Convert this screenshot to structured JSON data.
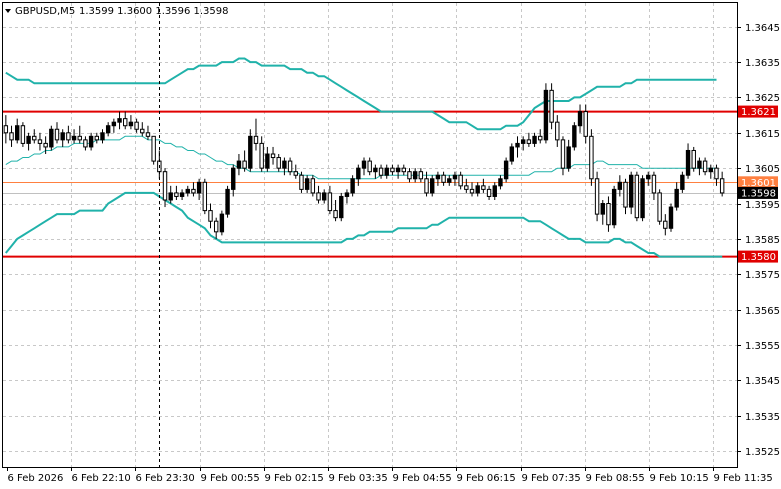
{
  "header": {
    "symbol_label": "GBPUSD,M5",
    "ohlc_label": "1.3599 1.3600 1.3596 1.3598"
  },
  "colors": {
    "background": "#ffffff",
    "grid": "#c8c8c8",
    "frame": "#000000",
    "candle": "#000000",
    "bollinger": "#20b2aa",
    "support_resistance": "#e00000",
    "bid_line": "#ff8040",
    "ask_line": "#c0c0c0",
    "current_tag": "#000000"
  },
  "chart_data": {
    "type": "candlestick",
    "title": "GBPUSD,M5",
    "y_ticks": [
      "1.3645",
      "1.3635",
      "1.3625",
      "1.3615",
      "1.3605",
      "1.3595",
      "1.3585",
      "1.3575",
      "1.3565",
      "1.3555",
      "1.3545",
      "1.3535",
      "1.3525"
    ],
    "x_ticks": [
      "6 Feb 2026",
      "6 Feb 22:10",
      "6 Feb 23:30",
      "9 Feb 00:55",
      "9 Feb 02:15",
      "9 Feb 03:35",
      "9 Feb 04:55",
      "9 Feb 06:15",
      "9 Feb 07:35",
      "9 Feb 08:55",
      "9 Feb 10:15",
      "9 Feb 11:35"
    ],
    "ylim": [
      1.35205,
      1.36517
    ],
    "grid": true,
    "horizontal_levels": [
      {
        "label": "1.3621",
        "value": 1.3621,
        "style": "support_resistance"
      },
      {
        "label": "1.3580",
        "value": 1.358,
        "style": "support_resistance"
      }
    ],
    "price_lines": [
      {
        "label": "1.3601",
        "value": 1.3601,
        "style": "bid_line"
      },
      {
        "label": "1.3598",
        "value": 1.3598,
        "style": "current_tag"
      }
    ],
    "session_separator_x_label": "6 Feb 23:30",
    "candles": [
      [
        1.3617,
        1.362,
        1.3612,
        1.3615
      ],
      [
        1.3615,
        1.3617,
        1.3611,
        1.3613
      ],
      [
        1.3613,
        1.3619,
        1.3612,
        1.3617
      ],
      [
        1.3617,
        1.3618,
        1.3611,
        1.3612
      ],
      [
        1.3612,
        1.3615,
        1.361,
        1.3614
      ],
      [
        1.3614,
        1.3616,
        1.3612,
        1.3613
      ],
      [
        1.3613,
        1.3615,
        1.361,
        1.3612
      ],
      [
        1.3612,
        1.3614,
        1.3609,
        1.3611
      ],
      [
        1.3611,
        1.3617,
        1.361,
        1.3616
      ],
      [
        1.3616,
        1.3618,
        1.3612,
        1.3613
      ],
      [
        1.3613,
        1.3616,
        1.3611,
        1.3615
      ],
      [
        1.3615,
        1.3617,
        1.3612,
        1.3613
      ],
      [
        1.3613,
        1.3616,
        1.3612,
        1.3614
      ],
      [
        1.3614,
        1.3617,
        1.3612,
        1.3613
      ],
      [
        1.3613,
        1.3614,
        1.361,
        1.3611
      ],
      [
        1.3611,
        1.3615,
        1.361,
        1.3614
      ],
      [
        1.3614,
        1.3615,
        1.3612,
        1.3613
      ],
      [
        1.3613,
        1.3616,
        1.3612,
        1.3615
      ],
      [
        1.3615,
        1.3618,
        1.3614,
        1.3617
      ],
      [
        1.3617,
        1.3619,
        1.3615,
        1.3618
      ],
      [
        1.3618,
        1.3621,
        1.3616,
        1.3619
      ],
      [
        1.3619,
        1.3621,
        1.3616,
        1.3617
      ],
      [
        1.3617,
        1.362,
        1.3616,
        1.3618
      ],
      [
        1.3618,
        1.3619,
        1.3615,
        1.3616
      ],
      [
        1.3616,
        1.3618,
        1.3614,
        1.3615
      ],
      [
        1.3615,
        1.3617,
        1.3613,
        1.3614
      ],
      [
        1.3614,
        1.3614,
        1.3606,
        1.3607
      ],
      [
        1.3607,
        1.361,
        1.3602,
        1.3604
      ],
      [
        1.3604,
        1.3605,
        1.3594,
        1.3596
      ],
      [
        1.3596,
        1.36,
        1.3595,
        1.3598
      ],
      [
        1.3598,
        1.36,
        1.3596,
        1.3597
      ],
      [
        1.3597,
        1.3599,
        1.3596,
        1.3598
      ],
      [
        1.3598,
        1.36,
        1.3597,
        1.3599
      ],
      [
        1.3599,
        1.3601,
        1.3597,
        1.3598
      ],
      [
        1.3598,
        1.3602,
        1.3596,
        1.3601
      ],
      [
        1.3601,
        1.3602,
        1.3592,
        1.3593
      ],
      [
        1.3593,
        1.3595,
        1.3588,
        1.359
      ],
      [
        1.359,
        1.3591,
        1.3585,
        1.3587
      ],
      [
        1.3587,
        1.3593,
        1.3586,
        1.3592
      ],
      [
        1.3592,
        1.36,
        1.3591,
        1.3599
      ],
      [
        1.3599,
        1.3606,
        1.3597,
        1.3605
      ],
      [
        1.3605,
        1.3609,
        1.3603,
        1.3607
      ],
      [
        1.3607,
        1.361,
        1.3604,
        1.3605
      ],
      [
        1.3605,
        1.3616,
        1.3604,
        1.3614
      ],
      [
        1.3614,
        1.3619,
        1.361,
        1.3612
      ],
      [
        1.3612,
        1.3614,
        1.3604,
        1.3605
      ],
      [
        1.3605,
        1.3611,
        1.3604,
        1.3609
      ],
      [
        1.3609,
        1.3611,
        1.3606,
        1.3608
      ],
      [
        1.3608,
        1.3609,
        1.3604,
        1.3605
      ],
      [
        1.3605,
        1.3608,
        1.3603,
        1.3607
      ],
      [
        1.3607,
        1.3608,
        1.3603,
        1.3604
      ],
      [
        1.3604,
        1.3606,
        1.3602,
        1.3603
      ],
      [
        1.3603,
        1.3604,
        1.3598,
        1.3599
      ],
      [
        1.3599,
        1.3603,
        1.3598,
        1.3602
      ],
      [
        1.3602,
        1.3603,
        1.3597,
        1.3598
      ],
      [
        1.3598,
        1.36,
        1.3595,
        1.3596
      ],
      [
        1.3596,
        1.3599,
        1.3595,
        1.3598
      ],
      [
        1.3598,
        1.36,
        1.3592,
        1.3593
      ],
      [
        1.3593,
        1.3596,
        1.359,
        1.3591
      ],
      [
        1.3591,
        1.3598,
        1.359,
        1.3597
      ],
      [
        1.3597,
        1.3599,
        1.3595,
        1.3598
      ],
      [
        1.3598,
        1.3603,
        1.3597,
        1.3602
      ],
      [
        1.3602,
        1.3606,
        1.36,
        1.3605
      ],
      [
        1.3605,
        1.3608,
        1.3603,
        1.3607
      ],
      [
        1.3607,
        1.3608,
        1.3603,
        1.3604
      ],
      [
        1.3604,
        1.3606,
        1.3602,
        1.3605
      ],
      [
        1.3605,
        1.3606,
        1.3602,
        1.3603
      ],
      [
        1.3603,
        1.3606,
        1.3602,
        1.3605
      ],
      [
        1.3605,
        1.3606,
        1.3603,
        1.3604
      ],
      [
        1.3604,
        1.3606,
        1.3602,
        1.3605
      ],
      [
        1.3605,
        1.3606,
        1.3603,
        1.3604
      ],
      [
        1.3604,
        1.3605,
        1.3601,
        1.3602
      ],
      [
        1.3602,
        1.3605,
        1.3601,
        1.3604
      ],
      [
        1.3604,
        1.3605,
        1.3601,
        1.3602
      ],
      [
        1.3602,
        1.3604,
        1.3597,
        1.3598
      ],
      [
        1.3598,
        1.3603,
        1.3597,
        1.3602
      ],
      [
        1.3602,
        1.3604,
        1.36,
        1.3603
      ],
      [
        1.3603,
        1.3604,
        1.36,
        1.3601
      ],
      [
        1.3601,
        1.3603,
        1.36,
        1.3602
      ],
      [
        1.3602,
        1.3604,
        1.36,
        1.3603
      ],
      [
        1.3603,
        1.3604,
        1.3599,
        1.36
      ],
      [
        1.36,
        1.3602,
        1.3598,
        1.3599
      ],
      [
        1.3599,
        1.3601,
        1.3597,
        1.3598
      ],
      [
        1.3598,
        1.3601,
        1.3597,
        1.36
      ],
      [
        1.36,
        1.3602,
        1.3598,
        1.3599
      ],
      [
        1.3599,
        1.36,
        1.3596,
        1.3597
      ],
      [
        1.3597,
        1.3601,
        1.3596,
        1.36
      ],
      [
        1.36,
        1.3603,
        1.3599,
        1.3602
      ],
      [
        1.3602,
        1.3608,
        1.3601,
        1.3607
      ],
      [
        1.3607,
        1.3612,
        1.3606,
        1.3611
      ],
      [
        1.3611,
        1.3614,
        1.3608,
        1.3612
      ],
      [
        1.3612,
        1.3614,
        1.361,
        1.3613
      ],
      [
        1.3613,
        1.3615,
        1.3611,
        1.3612
      ],
      [
        1.3612,
        1.3615,
        1.3611,
        1.3614
      ],
      [
        1.3614,
        1.3616,
        1.3612,
        1.3613
      ],
      [
        1.3613,
        1.3629,
        1.3612,
        1.3627
      ],
      [
        1.3627,
        1.3629,
        1.3616,
        1.3618
      ],
      [
        1.3618,
        1.362,
        1.3611,
        1.3613
      ],
      [
        1.3613,
        1.3614,
        1.3603,
        1.3605
      ],
      [
        1.3605,
        1.3613,
        1.3604,
        1.3611
      ],
      [
        1.3611,
        1.3618,
        1.361,
        1.3617
      ],
      [
        1.3617,
        1.3623,
        1.3615,
        1.3621
      ],
      [
        1.3621,
        1.3623,
        1.3612,
        1.3614
      ],
      [
        1.3614,
        1.3616,
        1.36,
        1.3602
      ],
      [
        1.3602,
        1.3604,
        1.359,
        1.3592
      ],
      [
        1.3592,
        1.3596,
        1.3589,
        1.3595
      ],
      [
        1.3595,
        1.3597,
        1.3587,
        1.3589
      ],
      [
        1.3589,
        1.36,
        1.3588,
        1.3599
      ],
      [
        1.3599,
        1.3603,
        1.3597,
        1.3601
      ],
      [
        1.3601,
        1.3602,
        1.3592,
        1.3594
      ],
      [
        1.3594,
        1.3604,
        1.3592,
        1.3603
      ],
      [
        1.3603,
        1.3604,
        1.359,
        1.3591
      ],
      [
        1.3591,
        1.3603,
        1.359,
        1.3602
      ],
      [
        1.3602,
        1.3604,
        1.36,
        1.3603
      ],
      [
        1.3603,
        1.3604,
        1.3596,
        1.3598
      ],
      [
        1.3598,
        1.3599,
        1.3589,
        1.359
      ],
      [
        1.359,
        1.3592,
        1.3586,
        1.3588
      ],
      [
        1.3588,
        1.3595,
        1.3587,
        1.3594
      ],
      [
        1.3594,
        1.3601,
        1.3593,
        1.3599
      ],
      [
        1.3599,
        1.3604,
        1.3598,
        1.3603
      ],
      [
        1.3603,
        1.3612,
        1.3602,
        1.361
      ],
      [
        1.361,
        1.3611,
        1.3604,
        1.3605
      ],
      [
        1.3605,
        1.3608,
        1.3603,
        1.3607
      ],
      [
        1.3607,
        1.3608,
        1.3603,
        1.3604
      ],
      [
        1.3604,
        1.3606,
        1.3602,
        1.3605
      ],
      [
        1.3605,
        1.3606,
        1.36,
        1.3602
      ],
      [
        1.3602,
        1.3604,
        1.3597,
        1.3598
      ]
    ],
    "bollinger_upper": [
      1.3632,
      1.3631,
      1.363,
      1.363,
      1.363,
      1.3629,
      1.3629,
      1.3629,
      1.3629,
      1.3629,
      1.3629,
      1.3629,
      1.3629,
      1.3629,
      1.3629,
      1.3629,
      1.3629,
      1.3629,
      1.3629,
      1.3629,
      1.3629,
      1.3629,
      1.3629,
      1.3629,
      1.3629,
      1.3629,
      1.3629,
      1.3629,
      1.3629,
      1.363,
      1.3631,
      1.3632,
      1.3633,
      1.3633,
      1.3634,
      1.3634,
      1.3634,
      1.3634,
      1.3635,
      1.3635,
      1.3635,
      1.3636,
      1.3636,
      1.3635,
      1.3635,
      1.3634,
      1.3634,
      1.3634,
      1.3634,
      1.3634,
      1.3633,
      1.3633,
      1.3633,
      1.3632,
      1.3632,
      1.3631,
      1.3631,
      1.363,
      1.3629,
      1.3628,
      1.3627,
      1.3626,
      1.3625,
      1.3624,
      1.3623,
      1.3622,
      1.3621,
      1.3621,
      1.3621,
      1.3621,
      1.3621,
      1.3621,
      1.3621,
      1.3621,
      1.3621,
      1.3621,
      1.362,
      1.3619,
      1.3618,
      1.3618,
      1.3618,
      1.3618,
      1.3617,
      1.3616,
      1.3616,
      1.3616,
      1.3616,
      1.3616,
      1.3617,
      1.3617,
      1.3617,
      1.3618,
      1.362,
      1.3622,
      1.3623,
      1.3624,
      1.3624,
      1.3624,
      1.3624,
      1.3624,
      1.3625,
      1.3625,
      1.3626,
      1.3627,
      1.3628,
      1.3628,
      1.3628,
      1.3628,
      1.3628,
      1.3629,
      1.3629,
      1.363,
      1.363,
      1.363,
      1.363,
      1.363,
      1.363,
      1.363,
      1.363,
      1.363,
      1.363,
      1.363,
      1.363,
      1.363,
      1.363,
      1.363
    ],
    "bollinger_middle": [
      1.3606,
      1.3607,
      1.3607,
      1.3608,
      1.3608,
      1.3609,
      1.3609,
      1.361,
      1.361,
      1.3611,
      1.3611,
      1.3611,
      1.3612,
      1.3612,
      1.3612,
      1.3612,
      1.3613,
      1.3613,
      1.3613,
      1.3613,
      1.3613,
      1.3614,
      1.3614,
      1.3614,
      1.3614,
      1.3613,
      1.3613,
      1.3613,
      1.3612,
      1.3612,
      1.3611,
      1.3611,
      1.361,
      1.361,
      1.3609,
      1.3609,
      1.3608,
      1.3607,
      1.3607,
      1.3606,
      1.3606,
      1.3605,
      1.3605,
      1.3604,
      1.3604,
      1.3604,
      1.3604,
      1.3604,
      1.3604,
      1.3604,
      1.3604,
      1.3604,
      1.3603,
      1.3603,
      1.3603,
      1.3602,
      1.3602,
      1.3602,
      1.3602,
      1.3602,
      1.3602,
      1.3602,
      1.3602,
      1.3602,
      1.3602,
      1.3602,
      1.3603,
      1.3603,
      1.3603,
      1.3603,
      1.3603,
      1.3603,
      1.3603,
      1.3603,
      1.3603,
      1.3603,
      1.3603,
      1.3603,
      1.3603,
      1.3603,
      1.3603,
      1.3603,
      1.3603,
      1.3603,
      1.3603,
      1.3603,
      1.3603,
      1.3603,
      1.3603,
      1.3603,
      1.3603,
      1.3603,
      1.3603,
      1.3604,
      1.3604,
      1.3604,
      1.3604,
      1.3605,
      1.3605,
      1.3605,
      1.3606,
      1.3606,
      1.3606,
      1.3606,
      1.3607,
      1.3607,
      1.3606,
      1.3606,
      1.3606,
      1.3606,
      1.3606,
      1.3606,
      1.3605,
      1.3605,
      1.3605,
      1.3605,
      1.3605,
      1.3605,
      1.3605,
      1.3605,
      1.3605,
      1.3605,
      1.3605,
      1.3605,
      1.3605,
      1.3605
    ],
    "bollinger_lower": [
      1.3581,
      1.3583,
      1.3585,
      1.3586,
      1.3587,
      1.3588,
      1.3589,
      1.359,
      1.3591,
      1.3592,
      1.3592,
      1.3592,
      1.3592,
      1.3593,
      1.3593,
      1.3593,
      1.3593,
      1.3593,
      1.3595,
      1.3596,
      1.3597,
      1.3598,
      1.3598,
      1.3598,
      1.3598,
      1.3598,
      1.3598,
      1.3597,
      1.3596,
      1.3595,
      1.3594,
      1.3593,
      1.3591,
      1.359,
      1.3589,
      1.3588,
      1.3586,
      1.3585,
      1.3584,
      1.3584,
      1.3584,
      1.3584,
      1.3584,
      1.3584,
      1.3584,
      1.3584,
      1.3584,
      1.3584,
      1.3584,
      1.3584,
      1.3584,
      1.3584,
      1.3584,
      1.3584,
      1.3584,
      1.3584,
      1.3584,
      1.3584,
      1.3584,
      1.3584,
      1.3585,
      1.3585,
      1.3586,
      1.3586,
      1.3587,
      1.3587,
      1.3587,
      1.3587,
      1.3587,
      1.3588,
      1.3588,
      1.3588,
      1.3588,
      1.3588,
      1.3588,
      1.3589,
      1.3589,
      1.359,
      1.3591,
      1.3591,
      1.3591,
      1.3591,
      1.3591,
      1.3591,
      1.3591,
      1.3591,
      1.3591,
      1.3591,
      1.3591,
      1.3591,
      1.3591,
      1.3591,
      1.359,
      1.359,
      1.359,
      1.3589,
      1.3588,
      1.3587,
      1.3586,
      1.3585,
      1.3585,
      1.3585,
      1.3584,
      1.3584,
      1.3584,
      1.3584,
      1.3584,
      1.3585,
      1.3585,
      1.3584,
      1.3584,
      1.3583,
      1.3582,
      1.3581,
      1.3581,
      1.358,
      1.358,
      1.358,
      1.358,
      1.358,
      1.358,
      1.358,
      1.358,
      1.358,
      1.358,
      1.358,
      1.358
    ]
  }
}
